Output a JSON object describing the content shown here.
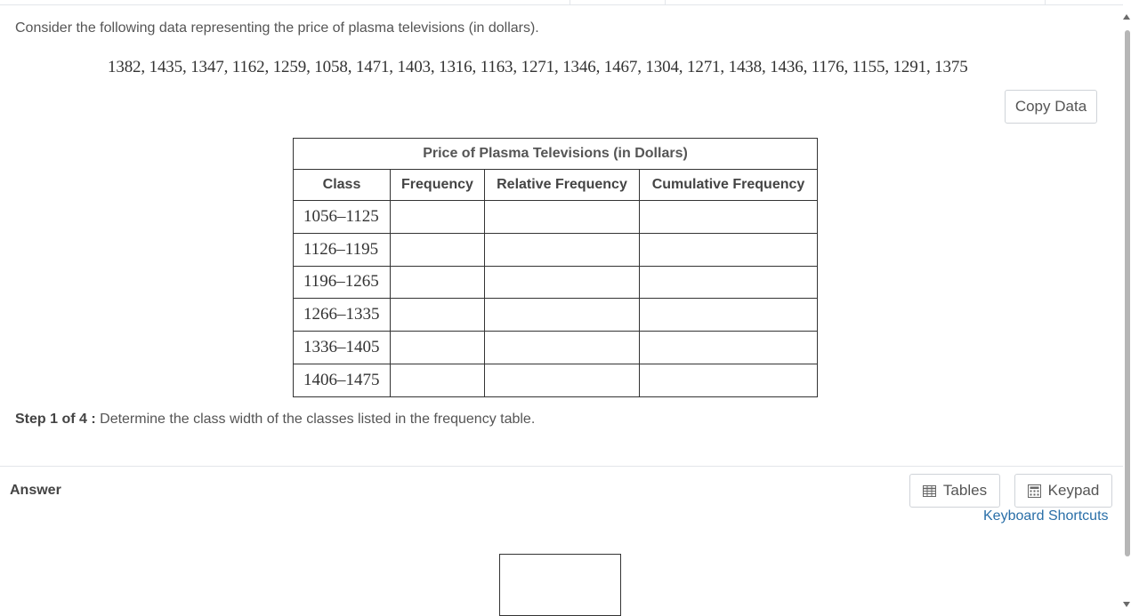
{
  "intro_text": "Consider the following data representing the price of plasma televisions (in dollars).",
  "data_values": "1382, 1435, 1347, 1162, 1259, 1058, 1471, 1403, 1316, 1163, 1271, 1346, 1467, 1304, 1271, 1438, 1436, 1176, 1155, 1291, 1375",
  "copy_button_label": "Copy Data",
  "table": {
    "title": "Price of Plasma Televisions (in Dollars)",
    "headers": [
      "Class",
      "Frequency",
      "Relative Frequency",
      "Cumulative Frequency"
    ],
    "rows": [
      {
        "class": "1056–1125",
        "frequency": "",
        "relative": "",
        "cumulative": ""
      },
      {
        "class": "1126–1195",
        "frequency": "",
        "relative": "",
        "cumulative": ""
      },
      {
        "class": "1196–1265",
        "frequency": "",
        "relative": "",
        "cumulative": ""
      },
      {
        "class": "1266–1335",
        "frequency": "",
        "relative": "",
        "cumulative": ""
      },
      {
        "class": "1336–1405",
        "frequency": "",
        "relative": "",
        "cumulative": ""
      },
      {
        "class": "1406–1475",
        "frequency": "",
        "relative": "",
        "cumulative": ""
      }
    ]
  },
  "step": {
    "label": "Step 1 of 4 :",
    "text": " Determine the class width of the classes listed in the frequency table."
  },
  "answer": {
    "label": "Answer",
    "tables_button_label": "Tables",
    "keypad_button_label": "Keypad",
    "keyboard_shortcuts_label": "Keyboard Shortcuts",
    "tables_icon": "table-icon",
    "keypad_icon": "calculator-icon",
    "input_value": ""
  },
  "colors": {
    "text": "#555555",
    "border": "#333333",
    "link": "#2a6fa8",
    "button_border": "#cfd3d8"
  }
}
